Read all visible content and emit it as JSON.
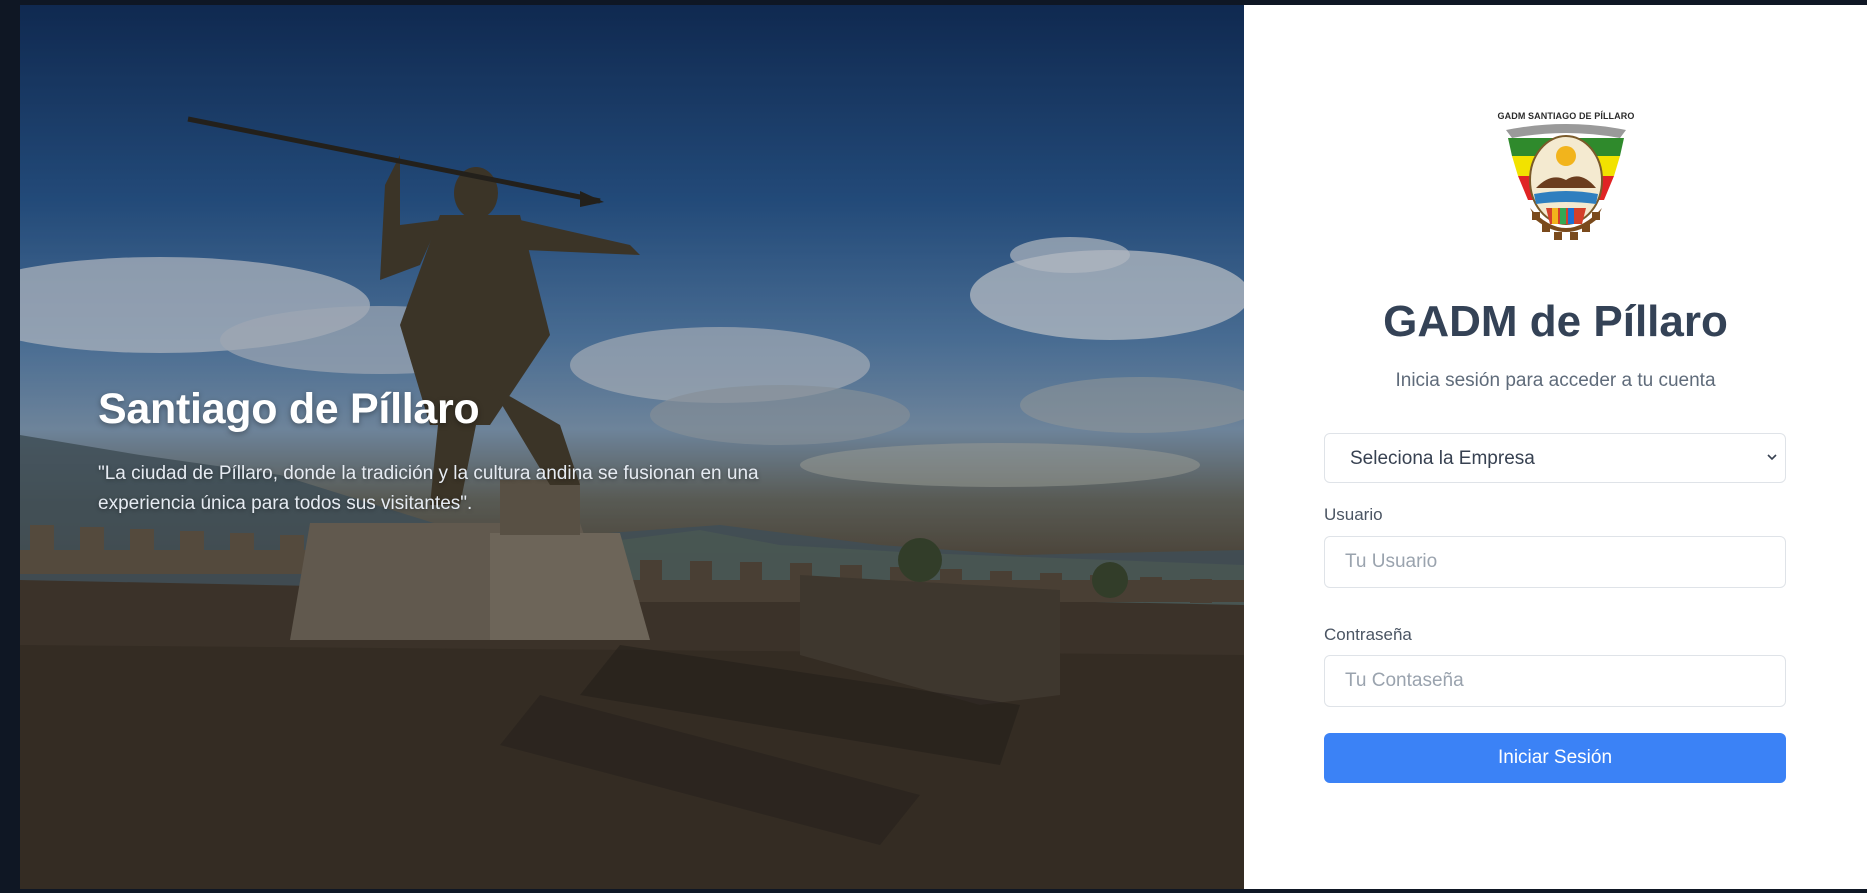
{
  "hero": {
    "title": "Santiago de Píllaro",
    "quote": "\"La ciudad de Píllaro, donde la tradición y la cultura andina se fusionan en una experiencia única para todos sus visitantes\"."
  },
  "logo": {
    "caption": "GADM SANTIAGO DE PÍLLARO",
    "icon": "municipal-coat-of-arms"
  },
  "login": {
    "title": "GADM de Píllaro",
    "subtitle": "Inicia sesión para acceder a tu cuenta",
    "company_select": {
      "selected": "Seleciona la Empresa"
    },
    "user_label": "Usuario",
    "user_placeholder": "Tu Usuario",
    "password_label": "Contraseña",
    "password_placeholder": "Tu Contaseña",
    "submit_label": "Iniciar Sesión"
  },
  "colors": {
    "accent": "#3b82f6",
    "title": "#344256",
    "panel_bg": "#ffffff"
  }
}
